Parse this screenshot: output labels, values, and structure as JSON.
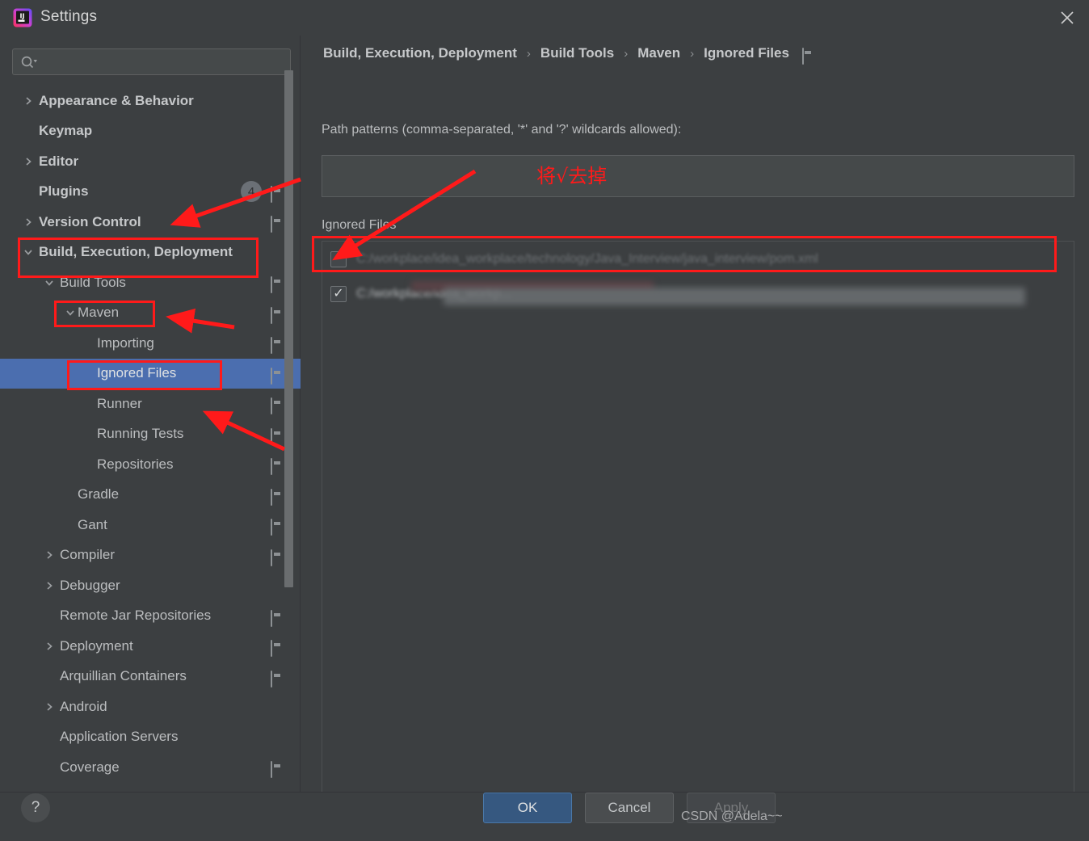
{
  "window": {
    "title": "Settings",
    "logo_icon": "intellij-idea-logo",
    "close_icon": "close-icon"
  },
  "sidebar": {
    "search": {
      "placeholder": "",
      "value": "",
      "icon": "search-icon"
    },
    "items": [
      {
        "label": "Appearance & Behavior",
        "indent": 0,
        "chevron": "right",
        "bold": true,
        "badge": "",
        "screen_icon": false,
        "selected": false
      },
      {
        "label": "Keymap",
        "indent": 0,
        "chevron": "none",
        "bold": true,
        "badge": "",
        "screen_icon": false,
        "selected": false
      },
      {
        "label": "Editor",
        "indent": 0,
        "chevron": "right",
        "bold": true,
        "badge": "",
        "screen_icon": false,
        "selected": false
      },
      {
        "label": "Plugins",
        "indent": 0,
        "chevron": "none",
        "bold": true,
        "badge": "4",
        "screen_icon": true,
        "selected": false
      },
      {
        "label": "Version Control",
        "indent": 0,
        "chevron": "right",
        "bold": true,
        "badge": "",
        "screen_icon": true,
        "selected": false
      },
      {
        "label": "Build, Execution, Deployment",
        "indent": 0,
        "chevron": "down",
        "bold": true,
        "badge": "",
        "screen_icon": false,
        "selected": false
      },
      {
        "label": "Build Tools",
        "indent": 1,
        "chevron": "down",
        "bold": false,
        "badge": "",
        "screen_icon": true,
        "selected": false
      },
      {
        "label": "Maven",
        "indent": 2,
        "chevron": "down",
        "bold": false,
        "badge": "",
        "screen_icon": true,
        "selected": false
      },
      {
        "label": "Importing",
        "indent": 3,
        "chevron": "none",
        "bold": false,
        "badge": "",
        "screen_icon": true,
        "selected": false
      },
      {
        "label": "Ignored Files",
        "indent": 3,
        "chevron": "none",
        "bold": false,
        "badge": "",
        "screen_icon": true,
        "selected": true
      },
      {
        "label": "Runner",
        "indent": 3,
        "chevron": "none",
        "bold": false,
        "badge": "",
        "screen_icon": true,
        "selected": false
      },
      {
        "label": "Running Tests",
        "indent": 3,
        "chevron": "none",
        "bold": false,
        "badge": "",
        "screen_icon": true,
        "selected": false
      },
      {
        "label": "Repositories",
        "indent": 3,
        "chevron": "none",
        "bold": false,
        "badge": "",
        "screen_icon": true,
        "selected": false
      },
      {
        "label": "Gradle",
        "indent": 2,
        "chevron": "none",
        "bold": false,
        "badge": "",
        "screen_icon": true,
        "selected": false
      },
      {
        "label": "Gant",
        "indent": 2,
        "chevron": "none",
        "bold": false,
        "badge": "",
        "screen_icon": true,
        "selected": false
      },
      {
        "label": "Compiler",
        "indent": 1,
        "chevron": "right",
        "bold": false,
        "badge": "",
        "screen_icon": true,
        "selected": false
      },
      {
        "label": "Debugger",
        "indent": 1,
        "chevron": "right",
        "bold": false,
        "badge": "",
        "screen_icon": false,
        "selected": false
      },
      {
        "label": "Remote Jar Repositories",
        "indent": 1,
        "chevron": "none",
        "bold": false,
        "badge": "",
        "screen_icon": true,
        "selected": false
      },
      {
        "label": "Deployment",
        "indent": 1,
        "chevron": "right",
        "bold": false,
        "badge": "",
        "screen_icon": true,
        "selected": false
      },
      {
        "label": "Arquillian Containers",
        "indent": 1,
        "chevron": "none",
        "bold": false,
        "badge": "",
        "screen_icon": true,
        "selected": false
      },
      {
        "label": "Android",
        "indent": 1,
        "chevron": "right",
        "bold": false,
        "badge": "",
        "screen_icon": false,
        "selected": false
      },
      {
        "label": "Application Servers",
        "indent": 1,
        "chevron": "none",
        "bold": false,
        "badge": "",
        "screen_icon": false,
        "selected": false
      },
      {
        "label": "Coverage",
        "indent": 1,
        "chevron": "none",
        "bold": false,
        "badge": "",
        "screen_icon": true,
        "selected": false
      }
    ]
  },
  "main": {
    "breadcrumb": [
      "Build, Execution, Deployment",
      "Build Tools",
      "Maven",
      "Ignored Files"
    ],
    "breadcrumb_separator": "›",
    "breadcrumb_icon": "screen-settings-icon",
    "path_patterns_label": "Path patterns (comma-separated, '*' and '?' wildcards allowed):",
    "path_patterns_value": "",
    "path_patterns_placeholder": "",
    "ignored_files_label": "Ignored Files",
    "files": [
      {
        "checked": false,
        "path": "C:/workplace/idea_workplace/technology/Java_Interview/java_interview/pom.xml",
        "redacted": false
      },
      {
        "checked": true,
        "path": "C:/workplace/idea_workp...",
        "redacted": true
      }
    ]
  },
  "bottom": {
    "help_label": "?",
    "ok_label": "OK",
    "cancel_label": "Cancel",
    "apply_label": "Apply",
    "watermark": "CSDN @Adela~~"
  },
  "annotations": {
    "note_text": "将√去掉",
    "color": "#ff1a1a"
  },
  "colors": {
    "window_bg": "#3c3f41",
    "selection_blue": "#4b6eaf",
    "ok_button_blue": "#365880",
    "annotation_red": "#ff1a1a",
    "text_primary": "#bbbdbf"
  }
}
